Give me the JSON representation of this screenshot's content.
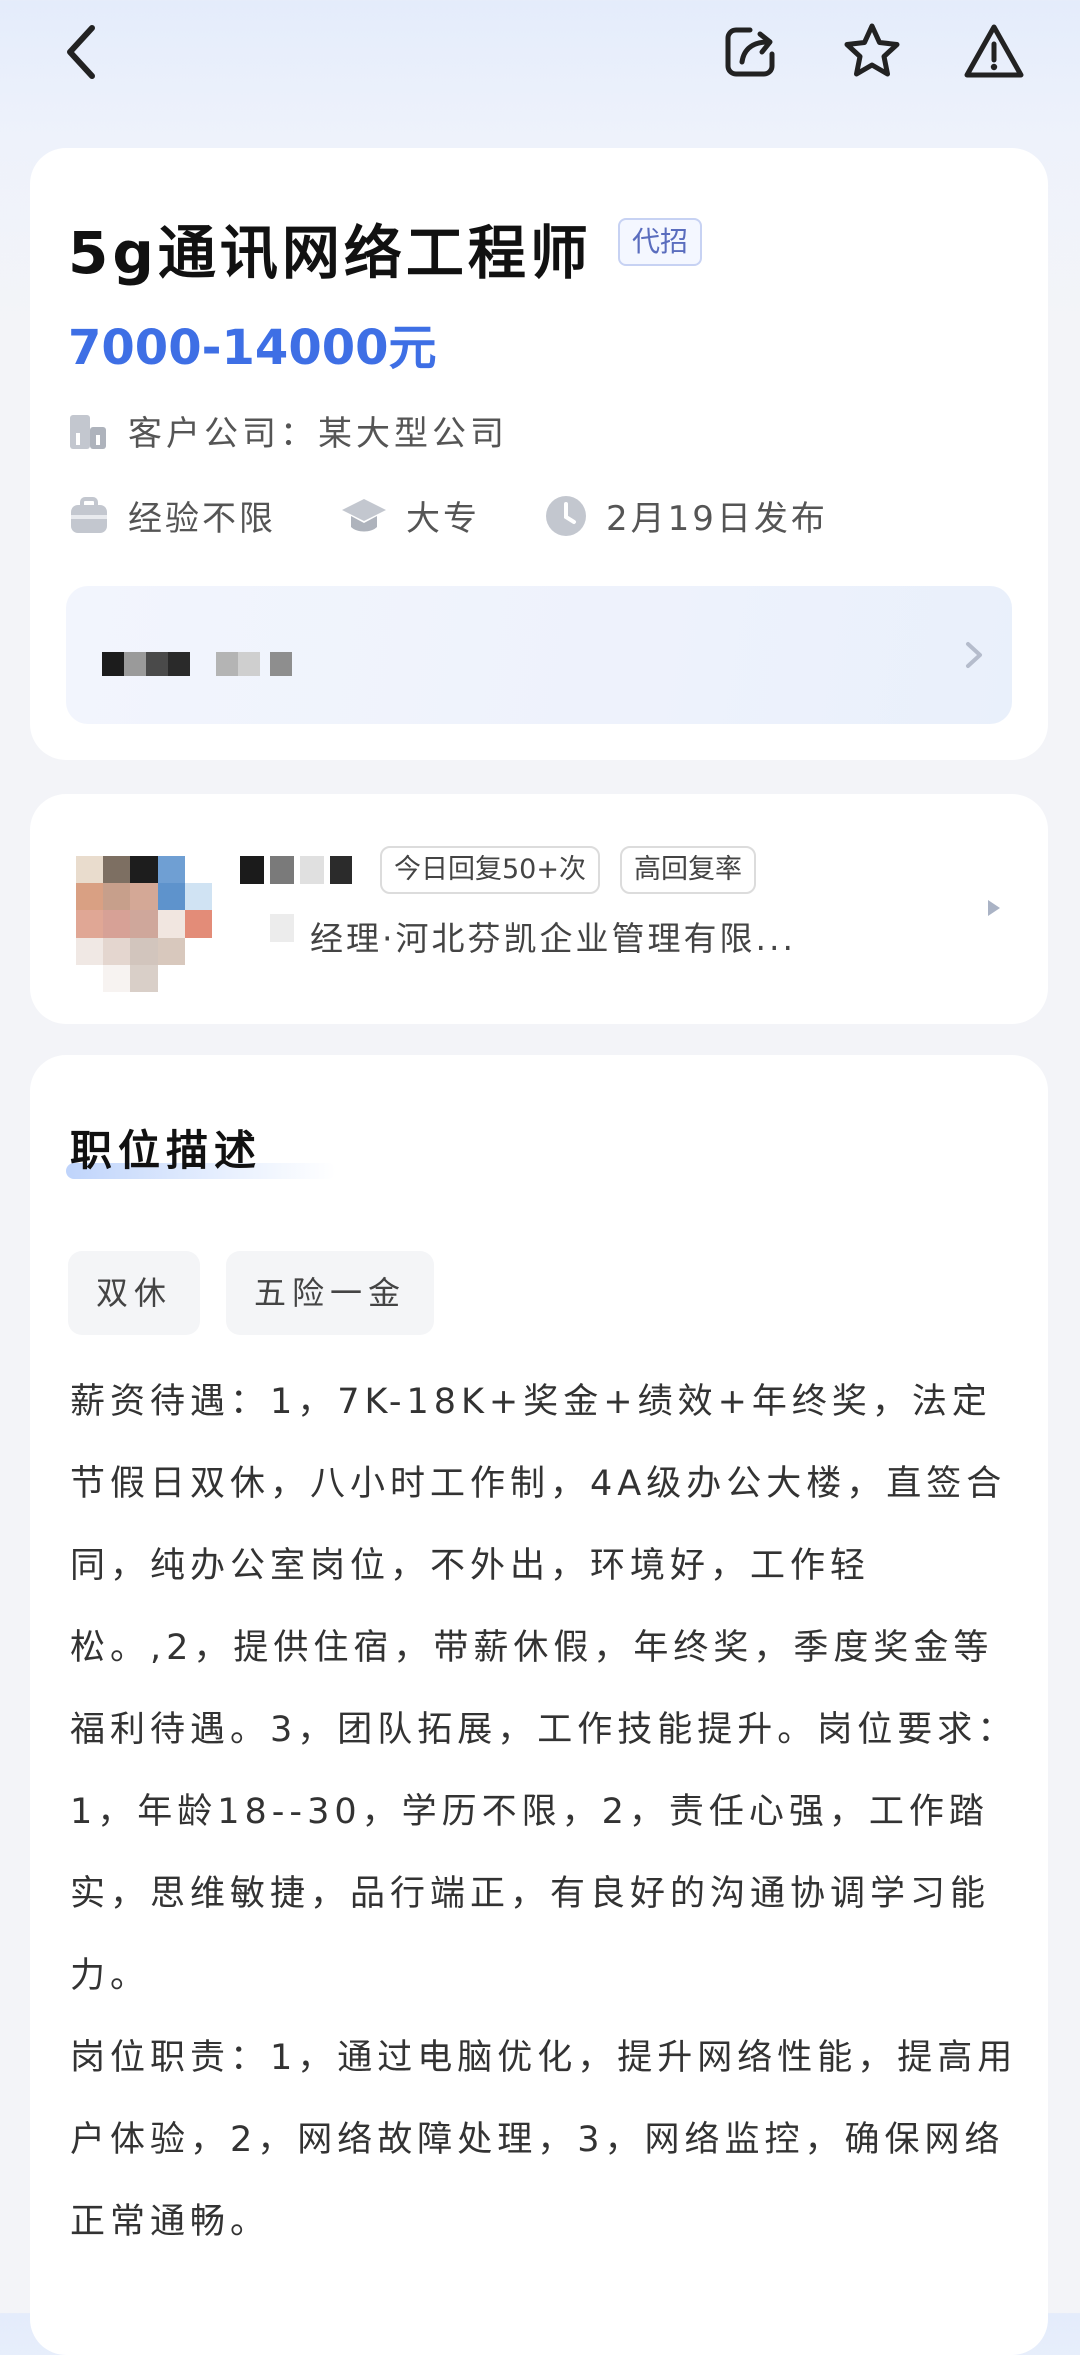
{
  "job": {
    "title": "5g通讯网络工程师",
    "agent_tag": "代招",
    "salary": "7000-14000元",
    "company": "客户公司：某大型公司",
    "experience": "经验不限",
    "education": "大专",
    "posted": "2月19日发布"
  },
  "recruiter": {
    "badge_reply": "今日回复50+次",
    "badge_rate": "高回复率",
    "subtitle": "经理·河北芬凯企业管理有限..."
  },
  "description": {
    "title": "职位描述",
    "tags": [
      "双休",
      "五险一金"
    ],
    "paragraphs": [
      "薪资待遇：1，7K-18K+奖金+绩效+年终奖，法定节假日双休，八小时工作制，4A级办公大楼，直签合同，纯办公室岗位，不外出，环境好，工作轻松。,2，提供住宿，带薪休假，年终奖，季度奖金等福利待遇。3，团队拓展，工作技能提升。岗位要求：1，年龄18--30，学历不限，2，责任心强，工作踏实，思维敏捷，品行端正，有良好的沟通协调学习能力。",
      "岗位职责：1，通过电脑优化，提升网络性能，提高用户体验，2，网络故障处理，3，网络监控，确保网络正常通畅。"
    ]
  },
  "icons": {
    "back": "chevron-left-icon",
    "share": "share-icon",
    "favorite": "star-icon",
    "report": "warning-icon"
  },
  "colors": {
    "accent": "#3e6fe5",
    "background": "#f3f4f8"
  }
}
